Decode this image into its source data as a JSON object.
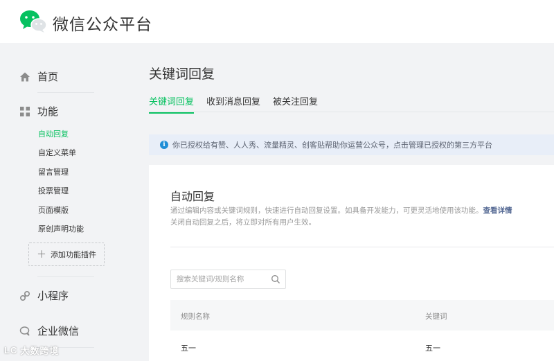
{
  "header": {
    "brand": "微信公众平台",
    "logo_icon": "wechat-logo-icon",
    "brand_color": "#07c160"
  },
  "sidebar": {
    "home": {
      "label": "首页",
      "icon": "home-icon"
    },
    "features": {
      "label": "功能",
      "icon": "grid-icon"
    },
    "sub_items": [
      {
        "label": "自动回复",
        "active": true
      },
      {
        "label": "自定义菜单",
        "active": false
      },
      {
        "label": "留言管理",
        "active": false
      },
      {
        "label": "投票管理",
        "active": false
      },
      {
        "label": "页面模版",
        "active": false
      },
      {
        "label": "原创声明功能",
        "active": false
      }
    ],
    "add_plugin": "添加功能插件",
    "mini_program": {
      "label": "小程序",
      "icon": "link-icon"
    },
    "work_wechat": {
      "label": "企业微信",
      "icon": "chat-bubble-icon"
    }
  },
  "page": {
    "title": "关键词回复",
    "tabs": [
      {
        "label": "关键词回复",
        "active": true
      },
      {
        "label": "收到消息回复",
        "active": false
      },
      {
        "label": "被关注回复",
        "active": false
      }
    ],
    "notice": "你已授权给有赞、人人秀、流量精灵、创客贴帮助你运营公众号，点击管理已授权的第三方平台"
  },
  "card": {
    "title": "自动回复",
    "desc_line1": "通过编辑内容或关键词规则，快速进行自动回复设置。如具备开发能力，可更灵活地使用该功能。",
    "desc_link": "查看详情",
    "desc_line2": "关闭自动回复之后，将立即对所有用户生效。",
    "search_placeholder": "搜索关键词/规则名称",
    "columns": [
      "规则名称",
      "关键词"
    ],
    "rows": [
      [
        "五一",
        "五一"
      ]
    ]
  },
  "watermark": {
    "logo": "LC",
    "text": "大数跨境"
  }
}
